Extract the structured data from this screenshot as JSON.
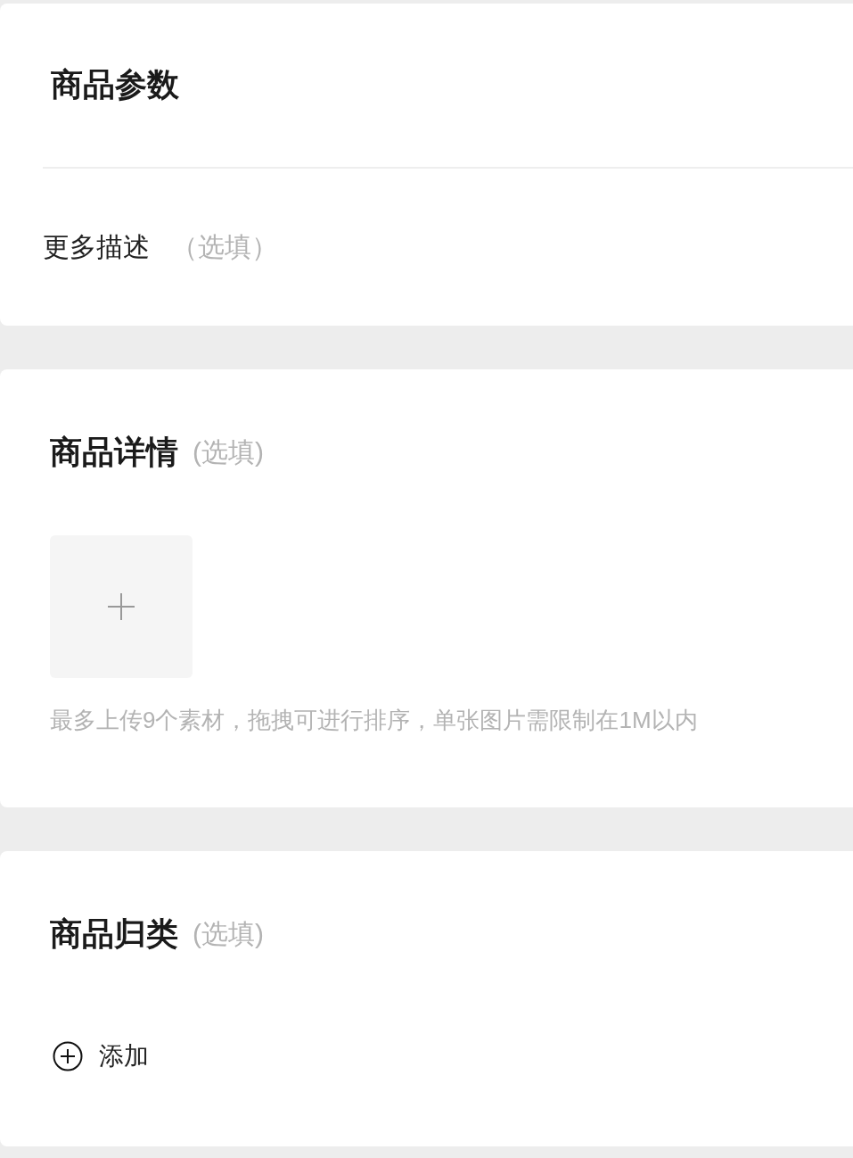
{
  "sections": [
    {
      "kind": "params",
      "title": "商品参数",
      "field": {
        "label": "更多描述",
        "optional": "（选填）"
      }
    },
    {
      "kind": "upload",
      "title": "商品详情",
      "optional": "(选填)",
      "hint": "最多上传9个素材，拖拽可进行排序，单张图片需限制在1M以内"
    },
    {
      "kind": "category",
      "title": "商品归类",
      "optional": "(选填)",
      "action": "添加"
    }
  ]
}
